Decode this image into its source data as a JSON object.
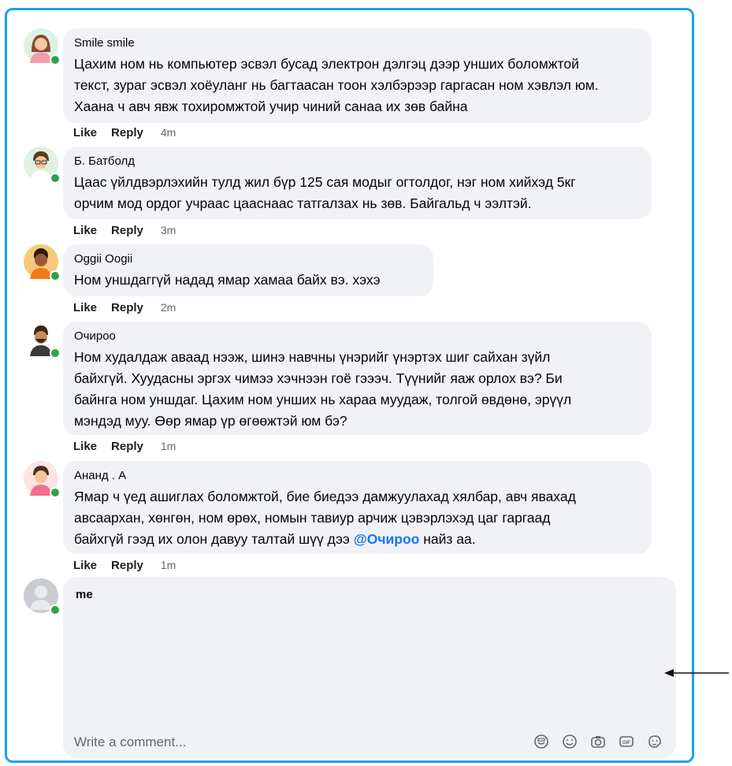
{
  "comments": [
    {
      "author": "Smile smile",
      "lines": [
        "Цахим ном нь компьютер эсвэл бусад электрон дэлгэц дээр унших боломжтой",
        "текст, зураг эсвэл хоёуланг нь багтаасан тоон хэлбэрээр гаргасан ном хэвлэл юм.",
        "Хаана ч авч явж тохиромжтой учир чиний санаа их зөв байна"
      ],
      "like": "Like",
      "reply": "Reply",
      "time": "4m"
    },
    {
      "author": "Б. Батболд",
      "lines": [
        "Цаас үйлдвэрлэхийн тулд жил бүр 125 сая модыг огтолдог, нэг ном хийхэд 5кг",
        "орчим мод ордог учраас цааснаас татгалзах нь зөв. Байгальд ч ээлтэй."
      ],
      "like": "Like",
      "reply": "Reply",
      "time": "3m"
    },
    {
      "author": "Oggii Oogii",
      "lines": [
        "Ном уншдаггүй надад ямар хамаа байх вэ. хэхэ"
      ],
      "like": "Like",
      "reply": "Reply",
      "time": "2m"
    },
    {
      "author": "Очироо",
      "lines": [
        "Ном худалдаж аваад нээж, шинэ навчны үнэрийг үнэртэх шиг сайхан зүйл",
        "байхгүй. Хуудасны эргэх чимээ хэчнээн гоё гэээч. Түүнийг яаж орлох вэ? Би",
        "байнга ном уншдаг. Цахим ном унших нь хараа муудаж, толгой өвдөнө, эрүүл",
        "мэндэд муу. Өөр ямар үр өгөөжтэй юм бэ?"
      ],
      "like": "Like",
      "reply": "Reply",
      "time": "1m"
    },
    {
      "author": "Ананд . А",
      "lines": [
        "Ямар ч үед ашиглах боломжтой, бие биедээ дамжуулахад хялбар, авч явахад",
        "авсаархан, хөнгөн, ном өрөх, номын тавиур арчиж цэвэрлэхэд цаг гаргаад"
      ],
      "last_line_before": "байхгүй гээд их олон давуу талтай шүү дээ ",
      "mention": "@Очироо",
      "last_line_after": " найз аа.",
      "like": "Like",
      "reply": "Reply",
      "time": "1m"
    }
  ],
  "composer": {
    "user": "me",
    "placeholder": "Write a comment...",
    "tools": [
      "sticker-icon",
      "emoji-icon",
      "camera-icon",
      "gif-icon",
      "avatar-sticker-icon"
    ]
  },
  "colors": {
    "frame": "#1aa3e8",
    "bubble": "#f0f2f5",
    "online": "#31a24c",
    "mention": "#1877f2"
  }
}
